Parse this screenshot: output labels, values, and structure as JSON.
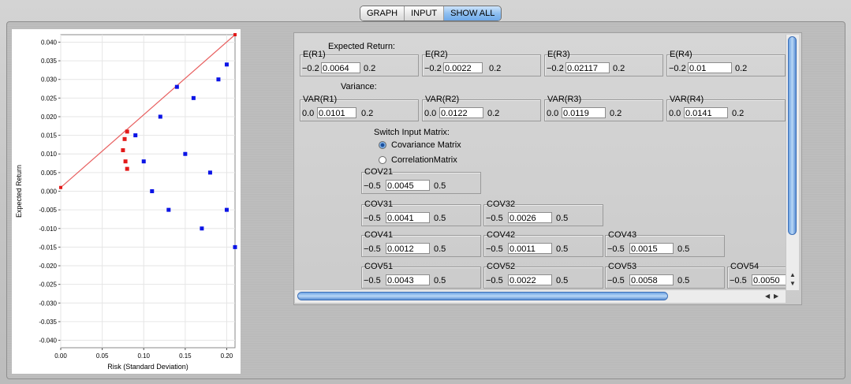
{
  "tabs": [
    {
      "label": "GRAPH",
      "active": false
    },
    {
      "label": "INPUT",
      "active": false
    },
    {
      "label": "SHOW ALL",
      "active": true
    }
  ],
  "chart_data": {
    "type": "scatter",
    "xlabel": "Risk (Standard Deviation)",
    "ylabel": "Expected Return",
    "xlim": [
      0,
      0.21
    ],
    "ylim": [
      -0.042,
      0.042
    ],
    "x_ticks": [
      "0.00",
      "0.05",
      "0.10",
      "0.15",
      "0.20"
    ],
    "y_ticks": [
      "0.040",
      "0.035",
      "0.030",
      "0.025",
      "0.020",
      "0.015",
      "0.010",
      "0.005",
      "0.000",
      "-0.005",
      "-0.010",
      "-0.015",
      "-0.020",
      "-0.025",
      "-0.030",
      "-0.035",
      "-0.040"
    ],
    "grid": true,
    "colors": {
      "portfolios": "#0b14e6",
      "frontier": "#e31a1a",
      "line": "#e86060"
    },
    "line": {
      "from": [
        0,
        0.001
      ],
      "to": [
        0.21,
        0.042
      ]
    },
    "series": [
      {
        "role": "portfolios",
        "points": [
          [
            0.09,
            0.015
          ],
          [
            0.12,
            0.02
          ],
          [
            0.15,
            0.01
          ],
          [
            0.18,
            0.005
          ],
          [
            0.2,
            -0.005
          ],
          [
            0.16,
            0.025
          ],
          [
            0.19,
            0.03
          ],
          [
            0.13,
            -0.005
          ],
          [
            0.17,
            -0.01
          ],
          [
            0.2,
            0.034
          ],
          [
            0.1,
            0.008
          ],
          [
            0.11,
            0.0
          ],
          [
            0.14,
            0.028
          ],
          [
            0.21,
            -0.015
          ]
        ]
      },
      {
        "role": "frontier",
        "points": [
          [
            0.075,
            0.011
          ],
          [
            0.077,
            0.014
          ],
          [
            0.078,
            0.008
          ],
          [
            0.08,
            0.016
          ],
          [
            0.08,
            0.006
          ]
        ]
      }
    ]
  },
  "inputs": {
    "expected_return_title": "Expected Return:",
    "variance_title": "Variance:",
    "switch_title": "Switch Input Matrix:",
    "radio_cov": "Covariance Matrix",
    "radio_corr": "CorrelationMatrix",
    "er": [
      {
        "label": "E(R1)",
        "lo": "−0.2",
        "value": "0.0064",
        "hi": "0.2"
      },
      {
        "label": "E(R2)",
        "lo": "−0.2",
        "value": "0.0022",
        "hi": "0.2"
      },
      {
        "label": "E(R3)",
        "lo": "−0.2",
        "value": "0.02117",
        "hi": "0.2"
      },
      {
        "label": "E(R4)",
        "lo": "−0.2",
        "value": "0.01",
        "hi": "0.2"
      }
    ],
    "var": [
      {
        "label": "VAR(R1)",
        "lo": "0.0",
        "value": "0.0101",
        "hi": "0.2"
      },
      {
        "label": "VAR(R2)",
        "lo": "0.0",
        "value": "0.0122",
        "hi": "0.2"
      },
      {
        "label": "VAR(R3)",
        "lo": "0.0",
        "value": "0.0119",
        "hi": "0.2"
      },
      {
        "label": "VAR(R4)",
        "lo": "0.0",
        "value": "0.0141",
        "hi": "0.2"
      }
    ],
    "cov": {
      "cov21": {
        "label": "COV21",
        "lo": "−0.5",
        "value": "0.0045",
        "hi": "0.5"
      },
      "cov31": {
        "label": "COV31",
        "lo": "−0.5",
        "value": "0.0041",
        "hi": "0.5"
      },
      "cov32": {
        "label": "COV32",
        "lo": "−0.5",
        "value": "0.0026",
        "hi": "0.5"
      },
      "cov41": {
        "label": "COV41",
        "lo": "−0.5",
        "value": "0.0012",
        "hi": "0.5"
      },
      "cov42": {
        "label": "COV42",
        "lo": "−0.5",
        "value": "0.0011",
        "hi": "0.5"
      },
      "cov43": {
        "label": "COV43",
        "lo": "−0.5",
        "value": "0.0015",
        "hi": "0.5"
      },
      "cov51": {
        "label": "COV51",
        "lo": "−0.5",
        "value": "0.0043",
        "hi": "0.5"
      },
      "cov52": {
        "label": "COV52",
        "lo": "−0.5",
        "value": "0.0022",
        "hi": "0.5"
      },
      "cov53": {
        "label": "COV53",
        "lo": "−0.5",
        "value": "0.0058",
        "hi": "0.5"
      },
      "cov54": {
        "label": "COV54",
        "lo": "−0.5",
        "value": "0.0050",
        "hi": ""
      }
    }
  }
}
